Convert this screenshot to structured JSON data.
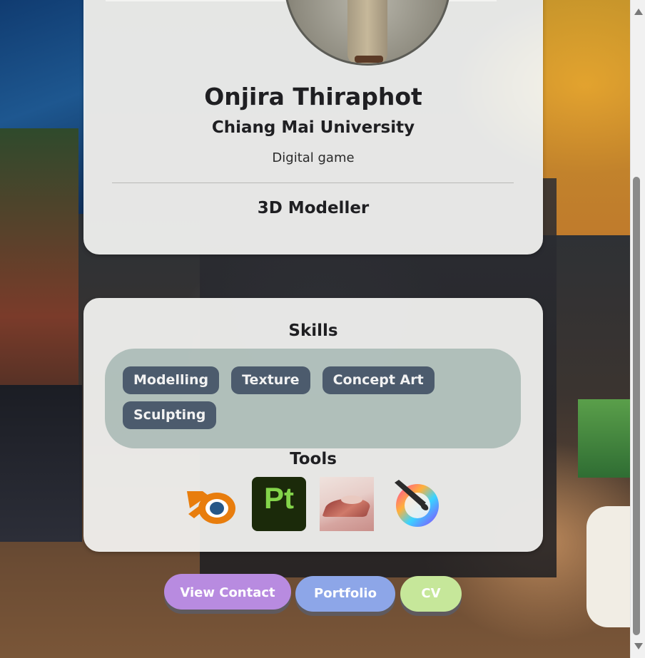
{
  "profile": {
    "name": "Onjira Thiraphot",
    "university": "Chiang Mai University",
    "major": "Digital game",
    "role": "3D Modeller"
  },
  "skills": {
    "title": "Skills",
    "items": [
      "Modelling",
      "Texture",
      "Concept Art",
      "Sculpting"
    ]
  },
  "tools": {
    "title": "Tools",
    "items": [
      {
        "icon": "blender-icon"
      },
      {
        "icon": "adobe-substance-painter-icon",
        "label": "Pt"
      },
      {
        "icon": "substance-designer-icon"
      },
      {
        "icon": "krita-icon"
      }
    ]
  },
  "buttons": {
    "contact": "View Contact",
    "portfolio": "Portfolio",
    "cv": "CV"
  },
  "colors": {
    "chip": "#4c5b6d",
    "contact_button": "#b88be0",
    "portfolio_button": "#8da6e8",
    "cv_button": "#c6e79a"
  }
}
